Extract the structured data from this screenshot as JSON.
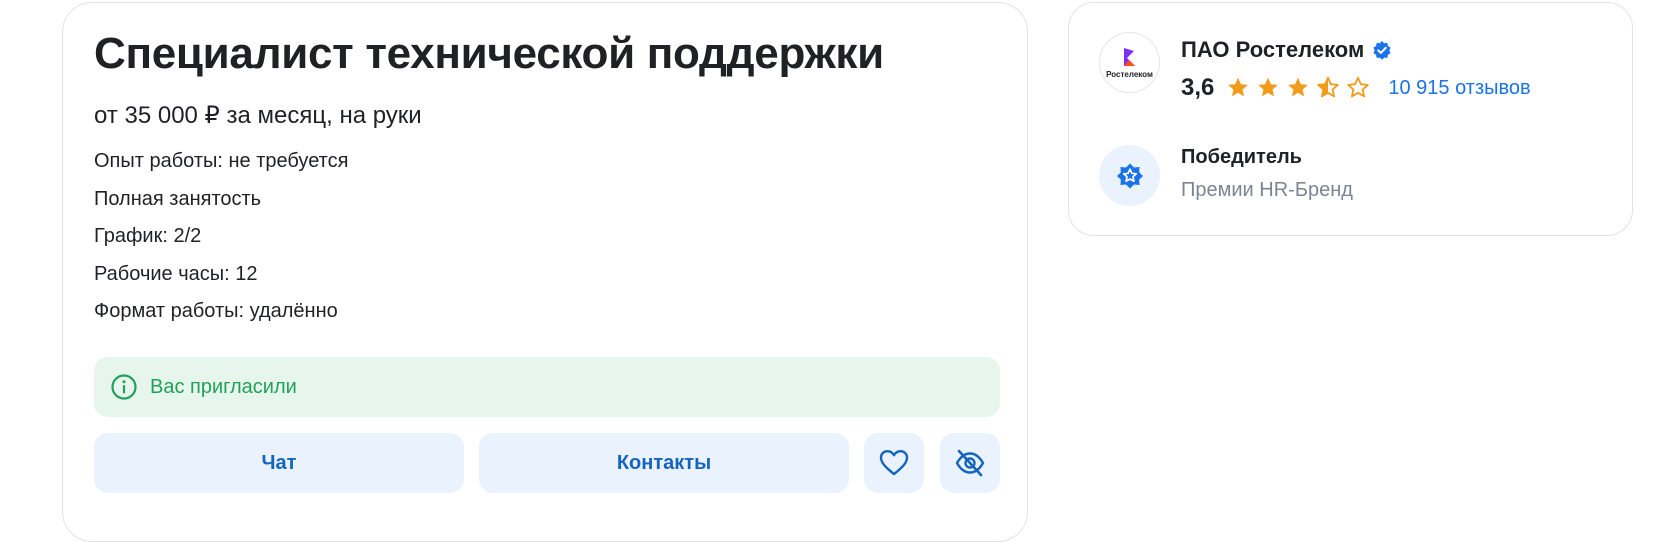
{
  "vacancy": {
    "title": "Специалист технической поддержки",
    "salary": "от 35 000 ₽ за месяц, на руки",
    "facts": [
      "Опыт работы: не требуется",
      "Полная занятость",
      "График: 2/2",
      "Рабочие часы: 12",
      "Формат работы: удалённо"
    ],
    "notice": {
      "icon": "info-icon",
      "text": "Вас пригласили",
      "color": "#22a05a",
      "background": "#e6f6ec"
    },
    "buttons": {
      "chat_label": "Чат",
      "contacts_label": "Контакты",
      "favorite_icon": "heart-icon",
      "hide_icon": "eye-off-icon"
    }
  },
  "company": {
    "logo_text": "Ростелеком",
    "name": "ПАО Ростелеком",
    "verified_icon": "verified-badge-icon",
    "rating": "3,6",
    "stars": 3.5,
    "star_color": "#f29a1a",
    "reviews": "10 915 отзывов",
    "award": {
      "icon": "award-star-icon",
      "title": "Победитель",
      "subtitle": "Премии HR-Бренд"
    }
  },
  "colors": {
    "accent": "#1565c0",
    "link": "#1a73e8",
    "button_bg": "#e9f2fd"
  }
}
